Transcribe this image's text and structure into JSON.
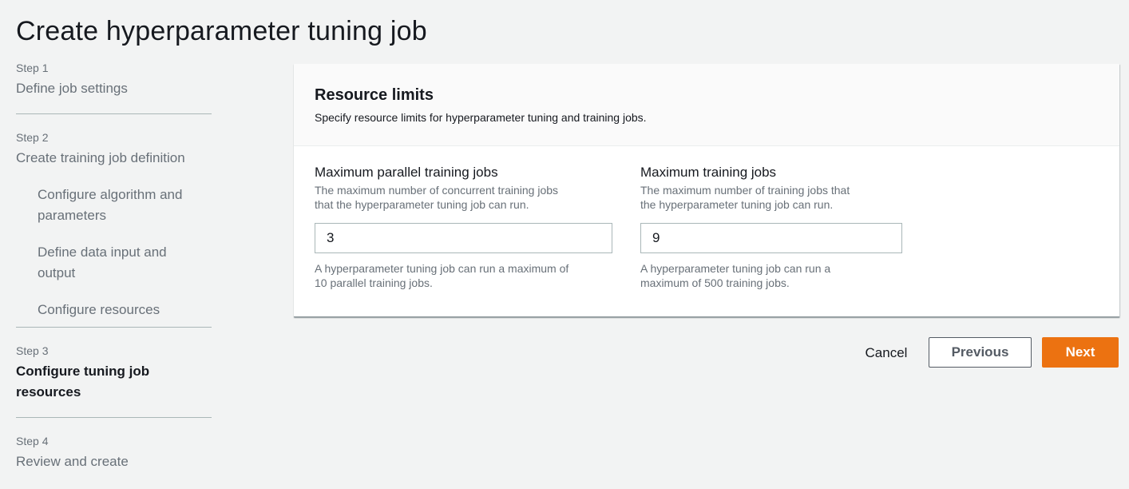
{
  "page": {
    "title": "Create hyperparameter tuning job"
  },
  "wizard": {
    "steps": [
      {
        "number": "Step 1",
        "title": "Define job settings",
        "substeps": []
      },
      {
        "number": "Step 2",
        "title": "Create training job definition",
        "substeps": [
          {
            "line1": "Configure algorithm and",
            "line2": "parameters"
          },
          {
            "line1": "Define data input and",
            "line2": "output"
          },
          {
            "line1": "Configure resources",
            "line2": ""
          }
        ]
      },
      {
        "number": "Step 3",
        "title_line1": "Configure tuning job",
        "title_line2": "resources",
        "active": true
      },
      {
        "number": "Step 4",
        "title": "Review and create"
      }
    ]
  },
  "panel": {
    "title": "Resource limits",
    "description": "Specify resource limits for hyperparameter tuning and training jobs.",
    "fields": [
      {
        "label": "Maximum parallel training jobs",
        "description_line1": "The maximum number of concurrent training jobs",
        "description_line2": "that the hyperparameter tuning job can run.",
        "value": "3",
        "hint_line1": "A hyperparameter tuning job can run a maximum of",
        "hint_line2": "10 parallel training jobs."
      },
      {
        "label": "Maximum training jobs",
        "description_line1": "The maximum number of training jobs that",
        "description_line2": "the hyperparameter tuning job can run.",
        "value": "9",
        "hint_line1": "A hyperparameter tuning job can run a",
        "hint_line2": "maximum of 500 training jobs."
      }
    ]
  },
  "actions": {
    "cancel_label": "Cancel",
    "previous_label": "Previous",
    "next_label": "Next"
  },
  "colors": {
    "primary_button": "#ec7211",
    "background": "#f2f3f3",
    "panel": "#ffffff",
    "muted_text": "#687078"
  }
}
